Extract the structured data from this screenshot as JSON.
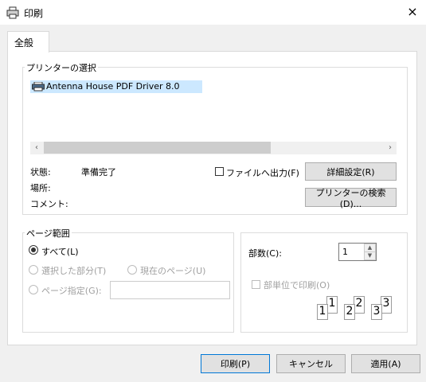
{
  "window": {
    "title": "印刷",
    "close_glyph": "×"
  },
  "tabs": [
    {
      "label": "全般"
    }
  ],
  "printer_select": {
    "legend": "プリンターの選択",
    "items": [
      {
        "label": "Antenna House PDF Driver 8.0"
      }
    ],
    "scroll_left": "‹",
    "scroll_right": "›"
  },
  "status": {
    "state_label": "状態:",
    "state_value": "準備完了",
    "location_label": "場所:",
    "comment_label": "コメント:"
  },
  "print_to_file": {
    "label": "ファイルへ出力(F)",
    "checked": false
  },
  "buttons": {
    "details": "詳細設定(R)",
    "find_printer": "プリンターの検索(D)...",
    "print": "印刷(P)",
    "cancel": "キャンセル",
    "apply": "適用(A)"
  },
  "page_range": {
    "legend": "ページ範囲",
    "all": "すべて(L)",
    "selection": "選択した部分(T)",
    "current": "現在のページ(U)",
    "pages": "ページ指定(G):",
    "pages_value": ""
  },
  "copies": {
    "label": "部数(C):",
    "value": "1",
    "collate_label": "部単位で印刷(O)",
    "collate_pages": [
      "1",
      "1",
      "2",
      "2",
      "3",
      "3"
    ]
  },
  "colors": {
    "selection": "#cce8ff",
    "default_button_border": "#0078d7"
  }
}
